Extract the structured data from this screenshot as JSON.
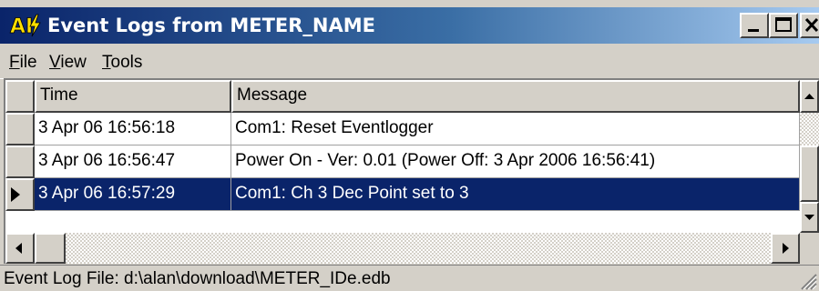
{
  "window": {
    "title": "Event Logs from METER_NAME"
  },
  "titlebar_buttons": [
    "minimize",
    "maximize",
    "close"
  ],
  "menu": {
    "items": [
      {
        "label": "File",
        "mnemonic": "F",
        "rest": "ile"
      },
      {
        "label": "View",
        "mnemonic": "V",
        "rest": "iew"
      },
      {
        "label": "Tools",
        "mnemonic": "T",
        "rest": "ools"
      }
    ]
  },
  "grid": {
    "columns": [
      "Time",
      "Message"
    ],
    "rows": [
      {
        "time": "3 Apr 06  16:56:18",
        "message": "Com1: Reset Eventlogger",
        "selected": false
      },
      {
        "time": "3 Apr 06  16:56:47",
        "message": "Power On - Ver: 0.01 (Power Off: 3 Apr 2006 16:56:41)",
        "selected": false
      },
      {
        "time": "3 Apr 06  16:57:29",
        "message": "Com1: Ch 3 Dec Point set to 3",
        "selected": true
      }
    ]
  },
  "status": {
    "text": "Event Log File: d:\\alan\\download\\METER_IDe.edb"
  },
  "colors": {
    "title_gradient_start": "#0a246a",
    "title_gradient_end": "#a6caf0",
    "selection": "#0a246a",
    "chrome": "#d4d0c8"
  },
  "icons": [
    "app-logo-icon",
    "minimize-icon",
    "maximize-icon",
    "close-icon",
    "row-pointer-icon",
    "scroll-up-icon",
    "scroll-down-icon",
    "scroll-left-icon",
    "scroll-right-icon",
    "resize-grip-icon"
  ]
}
